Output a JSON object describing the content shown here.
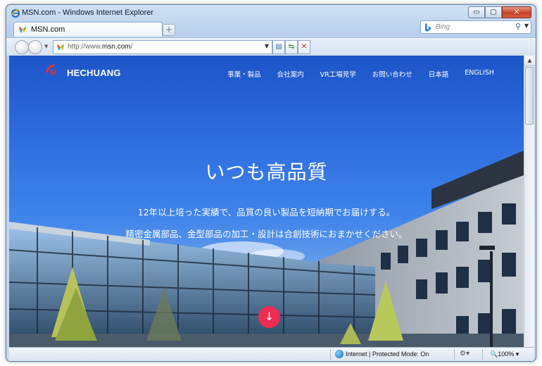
{
  "window": {
    "title": "MSN.com - Windows Internet Explorer",
    "controls": {
      "minimize": "▭",
      "maximize": "▢",
      "close": "✕"
    }
  },
  "tabs": [
    {
      "label": "MSN.com",
      "favicon": "msn-butterfly-icon"
    }
  ],
  "new_tab_label": "+",
  "search": {
    "placeholder": "Bing",
    "provider_icon": "bing-icon"
  },
  "address_bar": {
    "url_prefix": "http://www.",
    "url_host": "msn.com",
    "url_suffix": "/"
  },
  "statusbar": {
    "zone_text": "Internet | Protected Mode: On",
    "zoom_text": "100%"
  },
  "site": {
    "logo_text": "HECHUANG",
    "menu": [
      "事業・製品",
      "会社案内",
      "VR工場見学",
      "お問い合わせ",
      "日本語",
      "ENGLISH"
    ],
    "hero": {
      "title": "いつも高品質",
      "line1": "12年以上培った実績で、品質の良い製品を短納期でお届けする。",
      "line2": "精密金属部品、金型部品の加工・設計は合創技術におまかせください。"
    },
    "scroll_button_glyph": "↓"
  },
  "colors": {
    "sky_top": "#1c55c8",
    "accent_red": "#ee2c52",
    "window_frame": "#b9d1ec"
  }
}
